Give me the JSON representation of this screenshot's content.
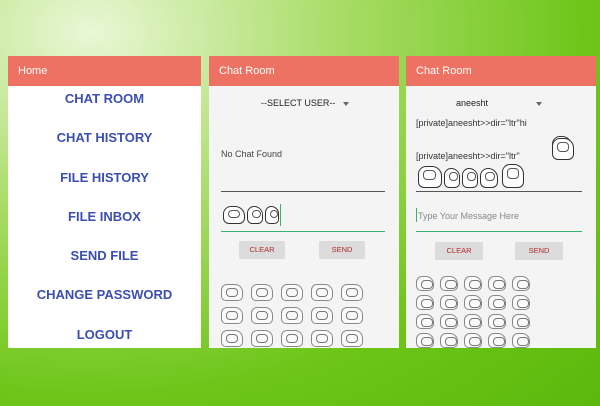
{
  "home": {
    "title": "Home",
    "menu": [
      "CHAT ROOM",
      "CHAT HISTORY",
      "FILE HISTORY",
      "FILE INBOX",
      "SEND FILE",
      "CHANGE PASSWORD",
      "LOGOUT"
    ]
  },
  "chat1": {
    "title": "Chat Room",
    "user_select": "--SELECT USER--",
    "status": "No Chat Found",
    "clear_label": "CLEAR",
    "send_label": "SEND"
  },
  "chat2": {
    "title": "Chat Room",
    "user_select": "aneesht",
    "messages": [
      "[private]aneesht>>dir=\"ltr\"hi",
      "[private]aneesht>>dir=\"ltr\""
    ],
    "input_placeholder": "Type Your Message Here",
    "clear_label": "CLEAR",
    "send_label": "SEND"
  },
  "colors": {
    "appbar": "#ee7263",
    "menu_text": "#3b4fb0",
    "button_text": "#b22b2b",
    "accent_line": "#3bb26b"
  }
}
